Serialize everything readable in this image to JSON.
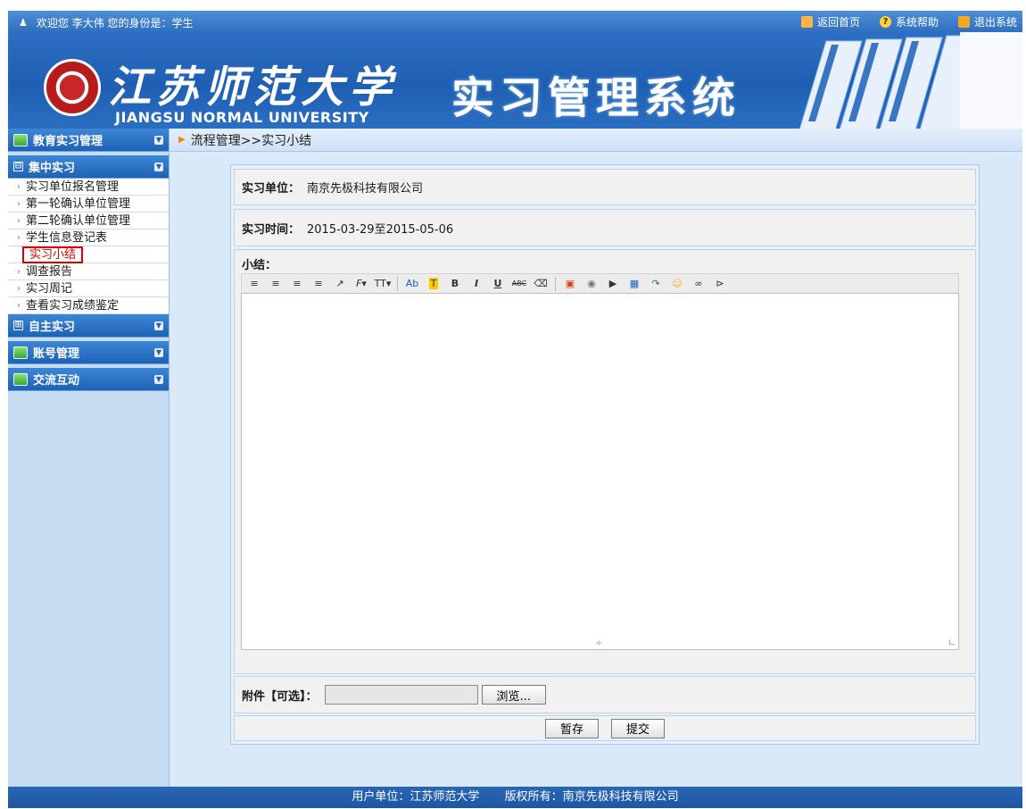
{
  "topbar": {
    "welcome": "欢迎您 李大伟 您的身份是：学生",
    "home": "返回首页",
    "help": "系统帮助",
    "logout": "退出系统"
  },
  "banner": {
    "school_cn": "江苏师范大学",
    "school_en": "JIANGSU NORMAL UNIVERSITY",
    "system_title": "实习管理系统"
  },
  "sidebar": {
    "groups": [
      {
        "label": "教育实习管理",
        "icon": "app-icon"
      },
      {
        "label": "集中实习",
        "icon": "collapse-box-icon",
        "items": [
          {
            "label": "实习单位报名管理"
          },
          {
            "label": "第一轮确认单位管理"
          },
          {
            "label": "第二轮确认单位管理"
          },
          {
            "label": "学生信息登记表"
          },
          {
            "label": "实习小结",
            "active": true
          },
          {
            "label": "调查报告"
          },
          {
            "label": "实习周记"
          },
          {
            "label": "查看实习成绩鉴定"
          }
        ]
      },
      {
        "label": "自主实习",
        "icon": "expand-box-icon"
      },
      {
        "label": "账号管理",
        "icon": "app-icon"
      },
      {
        "label": "交流互动",
        "icon": "app-icon"
      }
    ]
  },
  "breadcrumb": "流程管理>>实习小结",
  "form": {
    "unit_label": "实习单位：",
    "unit_value": "南京先极科技有限公司",
    "time_label": "实习时间：",
    "time_value": "2015-03-29至2015-05-06",
    "summary_label": "小结：",
    "attach_label": "附件【可选】：",
    "browse_label": "浏览...",
    "save_label": "暂存",
    "submit_label": "提交"
  },
  "editor_toolbar": [
    "align-left-icon",
    "align-center-icon",
    "align-right-icon",
    "align-justify-icon",
    "cursor-icon",
    "font-family-icon",
    "font-size-icon",
    "separator",
    "font-color-icon",
    "highlight-icon",
    "bold-icon",
    "italic-icon",
    "underline-icon",
    "strikethrough-icon",
    "eraser-icon",
    "separator",
    "image-icon",
    "flash-icon",
    "media-icon",
    "table-icon",
    "code-icon",
    "emoticon-icon",
    "link-icon",
    "unlink-icon"
  ],
  "footer": {
    "unit": "用户单位：江苏师范大学",
    "copyright": "版权所有：南京先极科技有限公司"
  }
}
